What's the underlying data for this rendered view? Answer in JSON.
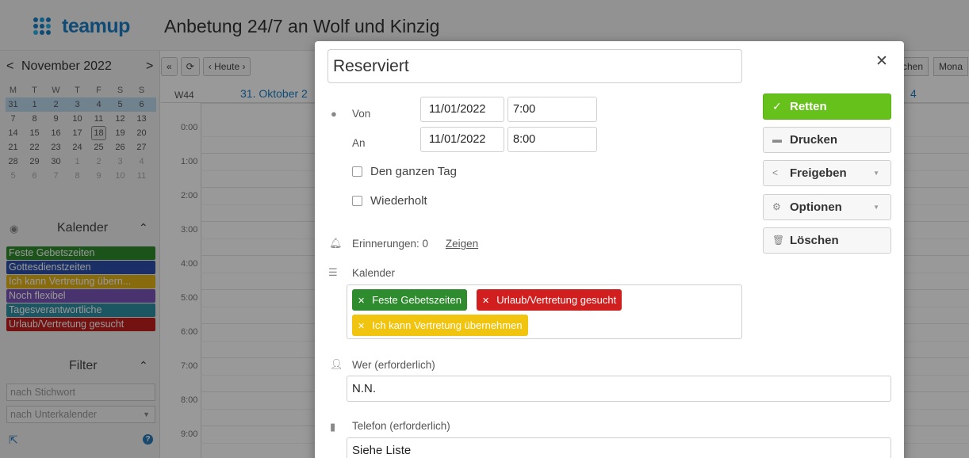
{
  "app": {
    "logo_text": "teamup",
    "title": "Anbetung 24/7 an Wolf und Kinzig"
  },
  "mini_calendar": {
    "prev": "<",
    "next": ">",
    "month_label": "November  2022",
    "weekdays": [
      "M",
      "T",
      "W",
      "T",
      "F",
      "S",
      "S"
    ],
    "weeks": [
      [
        "31",
        "1",
        "2",
        "3",
        "4",
        "5",
        "6"
      ],
      [
        "7",
        "8",
        "9",
        "10",
        "11",
        "12",
        "13"
      ],
      [
        "14",
        "15",
        "16",
        "17",
        "18",
        "19",
        "20"
      ],
      [
        "21",
        "22",
        "23",
        "24",
        "25",
        "26",
        "27"
      ],
      [
        "28",
        "29",
        "30",
        "1",
        "2",
        "3",
        "4"
      ],
      [
        "5",
        "6",
        "7",
        "8",
        "9",
        "10",
        "11"
      ]
    ]
  },
  "sidebar": {
    "calendars_title": "Kalender",
    "calendars": [
      {
        "label": "Feste Gebetszeiten",
        "color": "#2e8b2e"
      },
      {
        "label": "Gottesdienstzeiten",
        "color": "#2b4fa8"
      },
      {
        "label": "Ich kann Vertretung übern...",
        "color": "#e3b315"
      },
      {
        "label": "Noch flexibel",
        "color": "#7a55b8"
      },
      {
        "label": "Tagesverantwortliche",
        "color": "#2f8fa3"
      },
      {
        "label": "Urlaub/Vertretung gesucht",
        "color": "#c21d1d"
      }
    ],
    "filter_title": "Filter",
    "keyword_placeholder": "nach Stichwort",
    "subcalendar_placeholder": "nach Unterkalender"
  },
  "grid": {
    "today_button": "Heute",
    "week_label": "W44",
    "day_header": "31. Oktober 2",
    "right_day_header": "4",
    "tab_week": "chen",
    "tab_month": "Mona",
    "hours": [
      "0:00",
      "1:00",
      "2:00",
      "3:00",
      "4:00",
      "5:00",
      "6:00",
      "7:00",
      "8:00",
      "9:00"
    ]
  },
  "modal": {
    "title_value": "Reserviert",
    "von_label": "Von",
    "von_date": "11/01/2022",
    "von_time": "7:00",
    "an_label": "An",
    "an_date": "11/01/2022",
    "an_time": "8:00",
    "all_day_label": "Den ganzen Tag",
    "repeat_label": "Wiederholt",
    "reminders_label": "Erinnerungen: 0",
    "reminders_link": "Zeigen",
    "calendar_label": "Kalender",
    "tags": [
      {
        "label": "Feste Gebetszeiten",
        "color": "#2e8b2e"
      },
      {
        "label": "Urlaub/Vertretung gesucht",
        "color": "#d11f1f"
      },
      {
        "label": "Ich kann Vertretung übernehmen",
        "color": "#f1c40f"
      }
    ],
    "who_label": "Wer (erforderlich)",
    "who_value": "N.N.",
    "phone_label": "Telefon (erforderlich)",
    "phone_value": "Siehe Liste",
    "buttons": {
      "save": "Retten",
      "print": "Drucken",
      "share": "Freigeben",
      "options": "Optionen",
      "delete": "Löschen"
    },
    "save_color": "#66c21a"
  }
}
